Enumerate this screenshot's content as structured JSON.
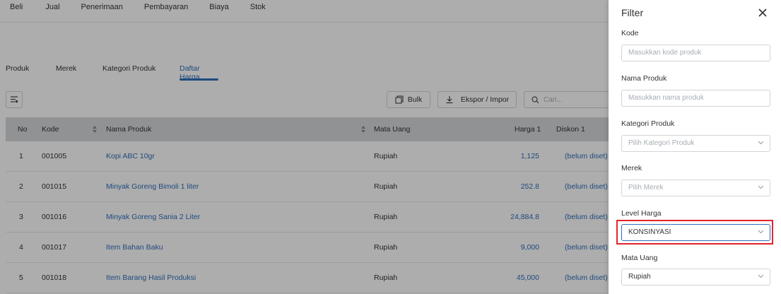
{
  "topnav": [
    "Beli",
    "Jual",
    "Penerimaan",
    "Pembayaran",
    "Biaya",
    "Stok"
  ],
  "subtabs": [
    {
      "label": "Produk"
    },
    {
      "label": "Merek"
    },
    {
      "label": "Kategori Produk"
    },
    {
      "label": "Daftar Harga",
      "active": true
    }
  ],
  "toolbar": {
    "bulk_label": "Bulk",
    "export_label": "Ekspor / Impor",
    "search_placeholder": "Cari..."
  },
  "table": {
    "headers": [
      "No",
      "Kode",
      "Nama Produk",
      "Mata Uang",
      "Harga 1",
      "Diskon 1"
    ],
    "rows": [
      {
        "no": "1",
        "kode": "001005",
        "nama": "Kopi ABC 10gr",
        "mata_uang": "Rupiah",
        "harga": "1,125",
        "diskon": "(belum diset)"
      },
      {
        "no": "2",
        "kode": "001015",
        "nama": "Minyak Goreng Bimoli 1 liter",
        "mata_uang": "Rupiah",
        "harga": "252.8",
        "diskon": "(belum diset)"
      },
      {
        "no": "3",
        "kode": "001016",
        "nama": "Minyak Goreng Sania 2 Liter",
        "mata_uang": "Rupiah",
        "harga": "24,884.8",
        "diskon": "(belum diset)"
      },
      {
        "no": "4",
        "kode": "001017",
        "nama": "Item Bahan Baku",
        "mata_uang": "Rupiah",
        "harga": "9,000",
        "diskon": "(belum diset)"
      },
      {
        "no": "5",
        "kode": "001018",
        "nama": "Item Barang Hasil Produksi",
        "mata_uang": "Rupiah",
        "harga": "45,000",
        "diskon": "(belum diset)"
      }
    ]
  },
  "filter": {
    "title": "Filter",
    "kode_label": "Kode",
    "kode_placeholder": "Masukkan kode produk",
    "nama_label": "Nama Produk",
    "nama_placeholder": "Masukkan nama produk",
    "kategori_label": "Kategori Produk",
    "kategori_placeholder": "Pilih Kategori Produk",
    "merek_label": "Merek",
    "merek_placeholder": "Pilih Merek",
    "level_label": "Level Harga",
    "level_value": "KONSINYASI",
    "mata_uang_label": "Mata Uang",
    "mata_uang_value": "Rupiah"
  },
  "colors": {
    "accent": "#2f6fba",
    "highlight": "#e0252b"
  }
}
